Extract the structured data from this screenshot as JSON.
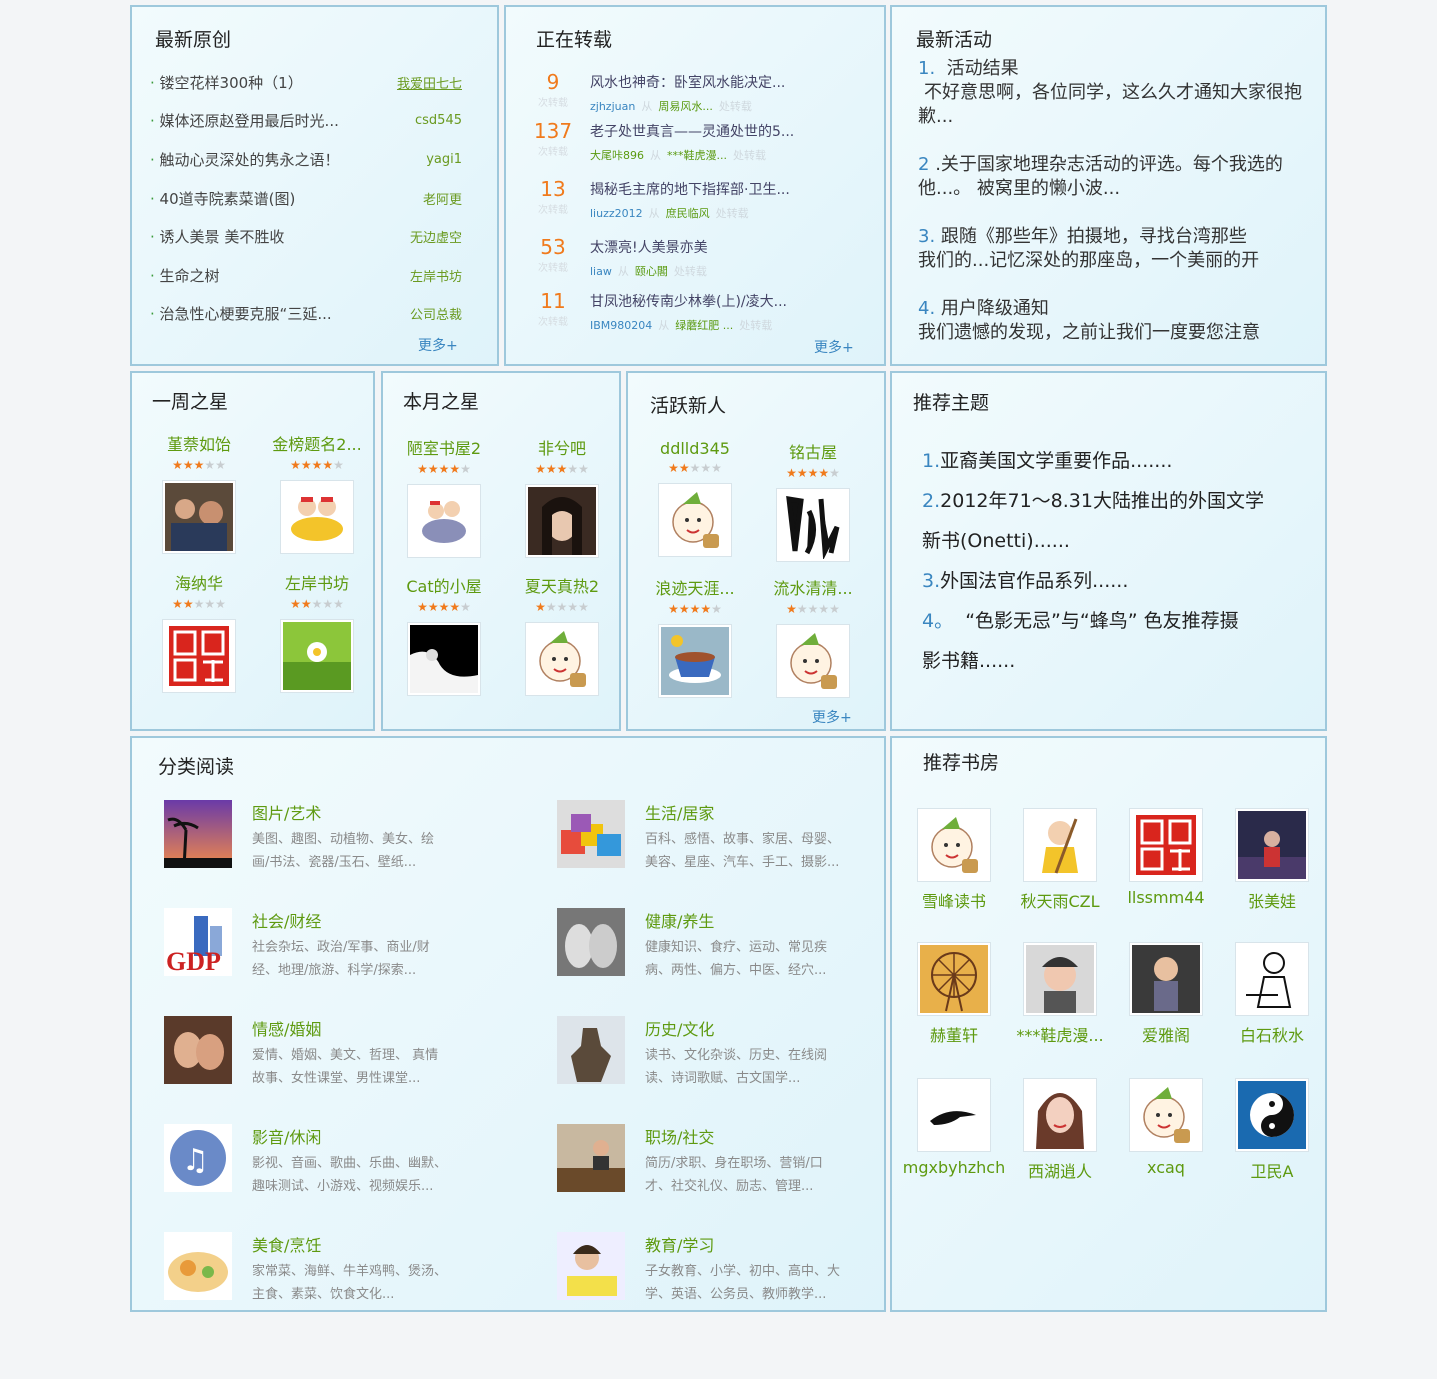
{
  "original": {
    "title": "最新原创",
    "items": [
      {
        "title": "镂空花样300种（1）",
        "author": "我爱田七七",
        "underline": true
      },
      {
        "title": "媒体还原赵登用最后时光...",
        "author": "csd545"
      },
      {
        "title": "触动心灵深处的隽永之语！",
        "author": "yagi1"
      },
      {
        "title": "40道寺院素菜谱(图)",
        "author": "老阿更"
      },
      {
        "title": "诱人美景 美不胜收",
        "author": "无边虚空"
      },
      {
        "title": "生命之树",
        "author": "左岸书坊"
      },
      {
        "title": "治急性心梗要克服“三延...",
        "author": "公司总裁"
      }
    ],
    "more": "更多+"
  },
  "repost": {
    "title": "正在转载",
    "count_label": "次转载",
    "items": [
      {
        "num": "9",
        "title": "风水也神奇：卧室风水能决定...",
        "user": "zjhzjuan",
        "source": "周易风水...",
        "tail": "处转载"
      },
      {
        "num": "137",
        "title": "老子处世真言——灵通处世的5...",
        "user": "大尾咔896",
        "source": "***鞋虎漫...",
        "tail": "处转载"
      },
      {
        "num": "13",
        "title": "揭秘毛主席的地下指挥部·卫生...",
        "user": "liuzz2012",
        "source": "庶民临风",
        "tail": "处转载"
      },
      {
        "num": "53",
        "title": "太漂亮!人美景亦美",
        "user": "liaw",
        "source": "颐心閣",
        "tail": "处转载"
      },
      {
        "num": "11",
        "title": "甘凤池秘传南少林拳(上)/凌大...",
        "user": "IBM980204",
        "source": "绿蘑红肥 ...",
        "tail": "处转载"
      }
    ],
    "more": "更多+"
  },
  "activity": {
    "title": "最新活动",
    "items": [
      {
        "num": "1.",
        "head": "活动结果",
        "body": "不好意思啊，各位同学，这么久才通知大家很抱歉..."
      },
      {
        "num": "2",
        "head": ".关于国家地理杂志活动的评选。每个我选的他...。 被窝里的懒小波...",
        "body": ""
      },
      {
        "num": "3.",
        "head": "跟随《那些年》拍摄地，寻找台湾那些",
        "body": "我们的...记忆深处的那座岛，一个美丽的开"
      },
      {
        "num": "4.",
        "head": "用户降级通知",
        "body": "我们遗憾的发现，之前让我们一度要您注意"
      }
    ]
  },
  "week_star": {
    "title": "一周之星",
    "users": [
      {
        "name": "堇萘如饴",
        "stars": 3,
        "icon": "crowd-photo"
      },
      {
        "name": "金榜题名2...",
        "stars": 4,
        "icon": "cartoon-ingot"
      },
      {
        "name": "海纳华",
        "stars": 2,
        "icon": "red-seal"
      },
      {
        "name": "左岸书坊",
        "stars": 2,
        "icon": "daisy-photo"
      }
    ]
  },
  "month_star": {
    "title": "本月之星",
    "users": [
      {
        "name": "陋室书屋2",
        "stars": 4,
        "icon": "cartoon-riders"
      },
      {
        "name": "非兮吧",
        "stars": 3,
        "icon": "girl-portrait"
      },
      {
        "name": "Cat的小屋",
        "stars": 4,
        "icon": "black-white-photo"
      },
      {
        "name": "夏天真热2",
        "stars": 1,
        "icon": "cartoon-boy"
      }
    ]
  },
  "new_people": {
    "title": "活跃新人",
    "users": [
      {
        "name": "ddlld345",
        "stars": 2,
        "icon": "cartoon-boy"
      },
      {
        "name": "铭古屋",
        "stars": 4,
        "icon": "ink-calligraphy"
      },
      {
        "name": "浪迹天涯...",
        "stars": 4,
        "icon": "teacup-photo"
      },
      {
        "name": "流水清清...",
        "stars": 1,
        "icon": "cartoon-boy"
      }
    ],
    "more": "更多+"
  },
  "topics": {
    "title": "推荐主题",
    "items": [
      {
        "num": "1.",
        "text": "亚裔美国文学重要作品......."
      },
      {
        "num": "2.",
        "text": "2012年71～8.31大陆推出的外国文学"
      },
      {
        "num": "",
        "text": "新书(Onetti)......"
      },
      {
        "num": "3.",
        "text": "外国法官作品系列......"
      },
      {
        "num": "4。",
        "text": "“色影无忌”与“蜂鸟” 色友推荐摄"
      },
      {
        "num": "",
        "text": "影书籍......"
      }
    ]
  },
  "categories": {
    "title": "分类阅读",
    "items": [
      {
        "title": "图片/艺术",
        "d1": "美图、趣图、动植物、美女、绘",
        "d2": "画/书法、瓷器/玉石、壁纸...",
        "icon": "sunset-palm-photo"
      },
      {
        "title": "生活/居家",
        "d1": "百科、感悟、故事、家居、母婴、",
        "d2": "美容、星座、汽车、手工、摄影...",
        "icon": "cushions-photo"
      },
      {
        "title": "社会/财经",
        "d1": "社会杂坛、政治/军事、商业/财",
        "d2": "经、地理/旅游、科学/探索...",
        "icon": "gdp-graphic"
      },
      {
        "title": "健康/养生",
        "d1": "健康知识、食疗、运动、常见疾",
        "d2": "病、两性、偏方、中医、经穴...",
        "icon": "feet-photo"
      },
      {
        "title": "情感/婚姻",
        "d1": "爱情、婚姻、美文、哲理、 真情",
        "d2": "故事、女性课堂、男性课堂...",
        "icon": "couple-photo"
      },
      {
        "title": "历史/文化",
        "d1": "读书、文化杂谈、历史、在线阅",
        "d2": "读、诗词歌赋、古文国学...",
        "icon": "statue-photo"
      },
      {
        "title": "影音/休闲",
        "d1": "影视、音画、歌曲、乐曲、幽默、",
        "d2": "趣味测试、小游戏、视频娱乐...",
        "icon": "music-notes-graphic"
      },
      {
        "title": "职场/社交",
        "d1": "简历/求职、身在职场、营销/口",
        "d2": "才、社交礼仪、励志、管理...",
        "icon": "office-photo"
      },
      {
        "title": "美食/烹饪",
        "d1": "家常菜、海鲜、牛羊鸡鸭、煲汤、",
        "d2": "主食、素菜、饮食文化...",
        "icon": "food-photo"
      },
      {
        "title": "教育/学习",
        "d1": "子女教育、小学、初中、高中、大",
        "d2": "学、英语、公务员、教师教学...",
        "icon": "child-studying-photo"
      }
    ]
  },
  "rooms": {
    "title": "推荐书房",
    "items": [
      {
        "name": "雪峰读书",
        "icon": "cartoon-boy"
      },
      {
        "name": "秋天雨CZL",
        "icon": "cartoon-monk"
      },
      {
        "name": "llssmm44",
        "icon": "red-seal"
      },
      {
        "name": "张美娃",
        "icon": "night-photo"
      },
      {
        "name": "赫董轩",
        "icon": "ferris-wheel-photo"
      },
      {
        "name": "***鞋虎漫...",
        "icon": "baby-photo"
      },
      {
        "name": "爱雅阁",
        "icon": "child-photo"
      },
      {
        "name": "白石秋水",
        "icon": "doctor-sketch"
      },
      {
        "name": "mgxbyhzhch",
        "icon": "bird-sketch"
      },
      {
        "name": "西湖逍人",
        "icon": "girl-illustration"
      },
      {
        "name": "xcaq",
        "icon": "cartoon-boy"
      },
      {
        "name": "卫民A",
        "icon": "yin-yang"
      }
    ]
  }
}
